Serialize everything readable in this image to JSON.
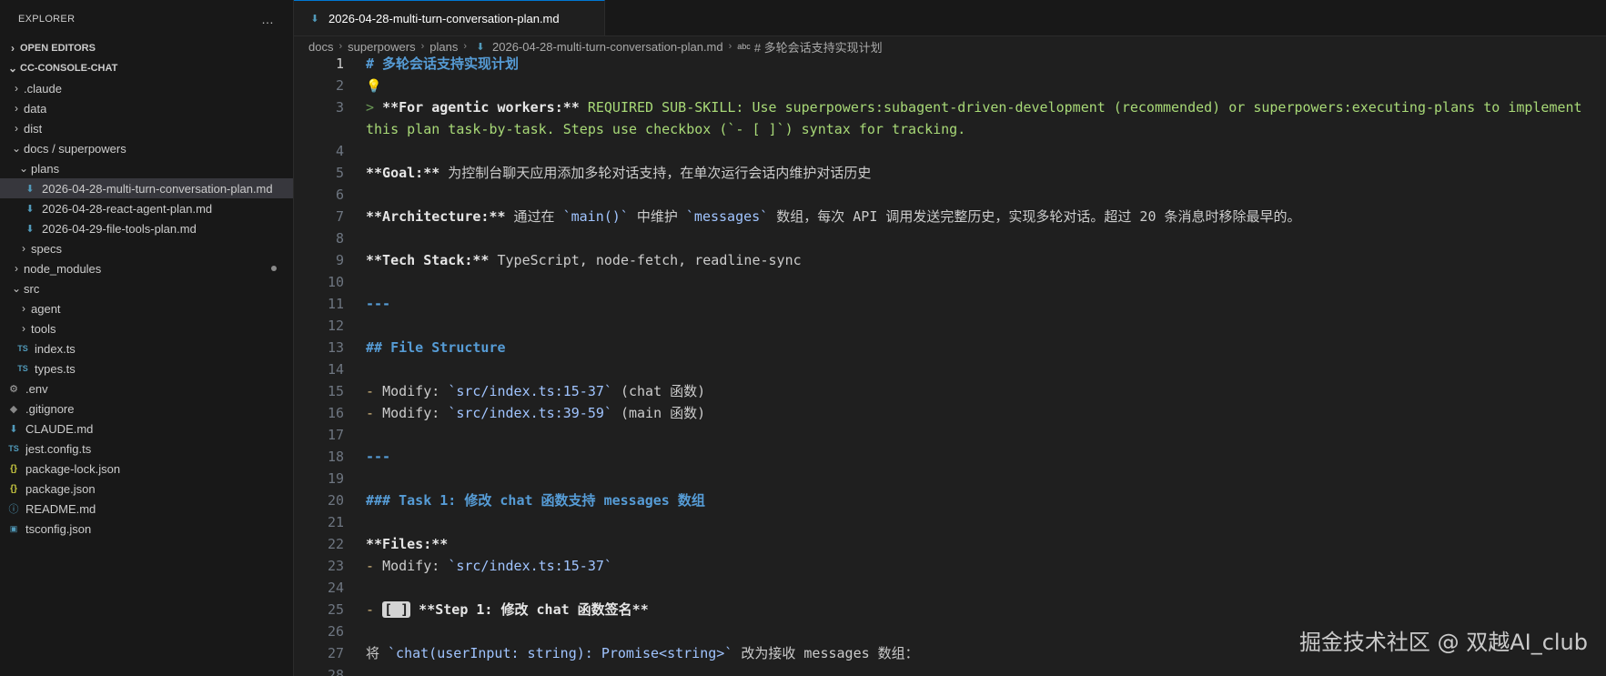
{
  "explorer": {
    "title": "EXPLORER",
    "more": "…",
    "open_editors": "OPEN EDITORS",
    "project": "CC-CONSOLE-CHAT",
    "items": [
      {
        "label": ".claude",
        "kind": "folder"
      },
      {
        "label": "data",
        "kind": "folder"
      },
      {
        "label": "dist",
        "kind": "folder"
      },
      {
        "label": "docs / superpowers",
        "kind": "folder-open"
      },
      {
        "label": "plans",
        "kind": "folder-open"
      },
      {
        "label": "2026-04-28-multi-turn-conversation-plan.md",
        "kind": "md",
        "selected": true
      },
      {
        "label": "2026-04-28-react-agent-plan.md",
        "kind": "md"
      },
      {
        "label": "2026-04-29-file-tools-plan.md",
        "kind": "md"
      },
      {
        "label": "specs",
        "kind": "folder"
      },
      {
        "label": "node_modules",
        "kind": "folder"
      },
      {
        "label": "src",
        "kind": "folder-open"
      },
      {
        "label": "agent",
        "kind": "folder"
      },
      {
        "label": "tools",
        "kind": "folder"
      },
      {
        "label": "index.ts",
        "kind": "ts"
      },
      {
        "label": "types.ts",
        "kind": "ts"
      },
      {
        "label": ".env",
        "kind": "gear"
      },
      {
        "label": ".gitignore",
        "kind": "git"
      },
      {
        "label": "CLAUDE.md",
        "kind": "md"
      },
      {
        "label": "jest.config.ts",
        "kind": "ts"
      },
      {
        "label": "package-lock.json",
        "kind": "json"
      },
      {
        "label": "package.json",
        "kind": "json"
      },
      {
        "label": "README.md",
        "kind": "info"
      },
      {
        "label": "tsconfig.json",
        "kind": "tsconfig"
      }
    ]
  },
  "tab": {
    "label": "2026-04-28-multi-turn-conversation-plan.md"
  },
  "breadcrumb": {
    "docs": "docs",
    "superpowers": "superpowers",
    "plans": "plans",
    "file": "2026-04-28-multi-turn-conversation-plan.md",
    "symbol_icon": "abc",
    "symbol": "# 多轮会话支持实现计划"
  },
  "code": {
    "l1": "# 多轮会话支持实现计划",
    "l3_marker": "> ",
    "l3_bold": "**For agentic workers:**",
    "l3_text": " REQUIRED SUB-SKILL: Use superpowers:subagent-driven-development (recommended) or superpowers:executing-plans to implement this plan task-by-task. Steps use checkbox (`- [ ]`) syntax for tracking.",
    "l5_bold": "**Goal:**",
    "l5_text": " 为控制台聊天应用添加多轮对话支持，在单次运行会话内维护对话历史",
    "l7_bold": "**Architecture:**",
    "l7_a": " 通过在 ",
    "l7_code1": "`main()`",
    "l7_b": " 中维护 ",
    "l7_code2": "`messages`",
    "l7_c": " 数组，每次 API 调用发送完整历史，实现多轮对话。超过 20 条消息时移除最早的。",
    "l9_bold": "**Tech Stack:**",
    "l9_text": " TypeScript, node-fetch, readline-sync",
    "l11": "---",
    "l13": "## File Structure",
    "l15_a": "- ",
    "l15_b": "Modify: ",
    "l15_code": "`src/index.ts:15-37`",
    "l15_c": " (chat 函数)",
    "l16_a": "- ",
    "l16_b": "Modify: ",
    "l16_code": "`src/index.ts:39-59`",
    "l16_c": " (main 函数)",
    "l18": "---",
    "l20": "### Task 1: 修改 chat 函数支持 messages 数组",
    "l22": "**Files:**",
    "l23_a": "- ",
    "l23_b": "Modify: ",
    "l23_code": "`src/index.ts:15-37`",
    "l25_a": "- ",
    "l25_box": "[ ]",
    "l25_bold": " **Step 1: 修改 chat 函数签名**",
    "l27_a": "将 ",
    "l27_code": "`chat(userInput: string): Promise<string>`",
    "l27_b": " 改为接收 messages 数组："
  },
  "line_numbers": [
    "1",
    "2",
    "3",
    "4",
    "5",
    "6",
    "7",
    "8",
    "9",
    "10",
    "11",
    "12",
    "13",
    "14",
    "15",
    "16",
    "17",
    "18",
    "19",
    "20",
    "21",
    "22",
    "23",
    "24",
    "25",
    "26",
    "27",
    "28"
  ],
  "watermark": "掘金技术社区 @ 双越AI_club"
}
